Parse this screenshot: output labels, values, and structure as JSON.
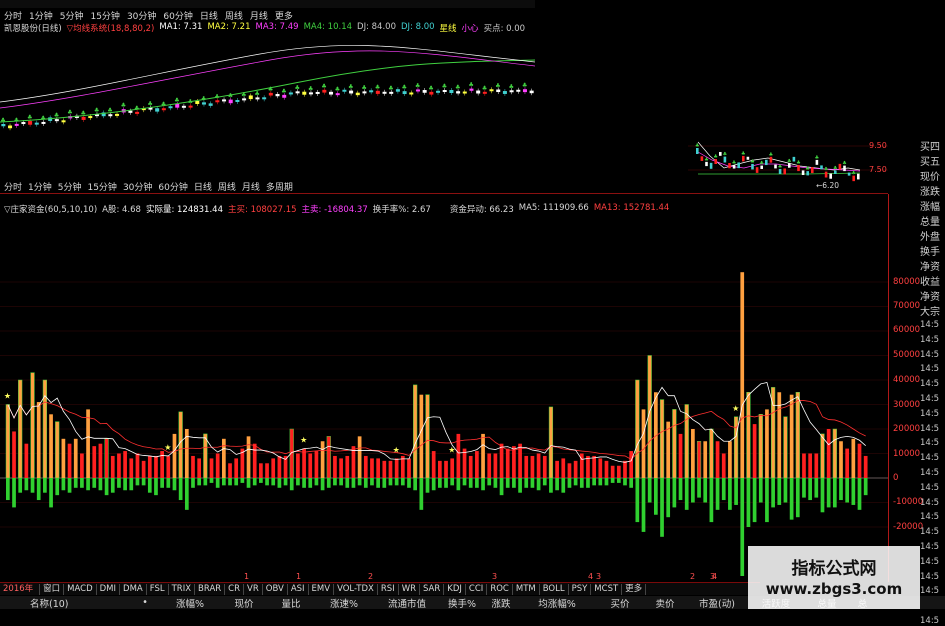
{
  "top_periods": [
    "分时",
    "1分钟",
    "5分钟",
    "15分钟",
    "30分钟",
    "60分钟",
    "日线",
    "周线",
    "月线",
    "更多"
  ],
  "main_legend": {
    "stock": "凯恩股份(日线)",
    "indicator": "▽均线系统(18,8,80,2)",
    "ma1": "MA1: 7.31",
    "ma2": "MA2: 7.21",
    "ma3": "MA3: 7.49",
    "ma4": "MA4: 10.14",
    "dj": "DJ: 84.00",
    "dj2": "DJ: 8.00",
    "xingdi": "星线",
    "xiaoxin": "小心",
    "maidian": "买点: 0.00"
  },
  "second_periods": [
    "分时",
    "1分钟",
    "5分钟",
    "15分钟",
    "30分钟",
    "60分钟",
    "日线",
    "周线",
    "月线",
    "多周期"
  ],
  "ind_legend": {
    "name": "▽庄家资金(60,5,10,10)",
    "a": "A股: 4.68",
    "sjl": "实际量: 124831.44",
    "zhuru": "主买: 108027.15",
    "zhumai": "主卖: -16804.37",
    "hsl": "换手率%: 2.67",
    "zjyd": "资金异动: 66.23",
    "ma5": "MA5: 111909.66",
    "ma13": "MA13: 152781.44"
  },
  "mini_chart": {
    "label_950": "9.50",
    "label_750": "7.50",
    "arrow_label": "←6.20"
  },
  "y_axis": [
    {
      "v": "80000",
      "y": 282
    },
    {
      "v": "70000",
      "y": 306
    },
    {
      "v": "60000",
      "y": 330
    },
    {
      "v": "50000",
      "y": 355
    },
    {
      "v": "40000",
      "y": 380
    },
    {
      "v": "30000",
      "y": 405
    },
    {
      "v": "20000",
      "y": 429
    },
    {
      "v": "10000",
      "y": 454
    },
    {
      "v": "0",
      "y": 478
    },
    {
      "v": "-10000",
      "y": 502
    },
    {
      "v": "-20000",
      "y": 527
    }
  ],
  "right_panel": [
    "买四",
    "买五",
    "现价",
    "涨跌",
    "涨幅",
    "总量",
    "外盘",
    "换手",
    "净资",
    "收益",
    "净资",
    "大宗"
  ],
  "right_times": [
    "14:5",
    "14:5",
    "14:5",
    "14:5",
    "14:5",
    "14:5",
    "14:5",
    "14:5",
    "14:5",
    "14:5",
    "14:5",
    "14:5",
    "14:5",
    "14:5",
    "14:5",
    "14:5",
    "14:5",
    "14:5",
    "14:5",
    "14:5",
    "14:5"
  ],
  "tabs": [
    "2016年",
    "窗口",
    "MACD",
    "DMI",
    "DMA",
    "FSL",
    "TRIX",
    "BRAR",
    "CR",
    "VR",
    "OBV",
    "ASI",
    "EMV",
    "VOL-TDX",
    "RSI",
    "WR",
    "SAR",
    "KDJ",
    "CCI",
    "ROC",
    "MTM",
    "BOLL",
    "PSY",
    "MCST",
    "更多"
  ],
  "header_cols": [
    "名称(10)",
    "•",
    "涨幅%",
    "现价",
    "量比",
    "涨速%",
    "流通市值",
    "换手%",
    "涨跌",
    "均涨幅%",
    "买价",
    "卖价",
    "市盈(动)",
    "活跃度",
    "总量",
    "总"
  ],
  "watermark": {
    "title": "指标公式网",
    "url": "www.zbgs3.com"
  },
  "markers": [
    "1",
    "1",
    "2",
    "3",
    "4",
    "3",
    "2",
    "3",
    "4"
  ],
  "chart_data": {
    "type": "bar",
    "series": [
      {
        "values": [
          30,
          19,
          40,
          14,
          43,
          31,
          40,
          26,
          23,
          16,
          14,
          16,
          10,
          28,
          13,
          14,
          16,
          9,
          10,
          11,
          8,
          10,
          7,
          9,
          9,
          11,
          9,
          18,
          27,
          20,
          9,
          8,
          18,
          8,
          10,
          16,
          6,
          8,
          12,
          17,
          14,
          6,
          6,
          8,
          9,
          9,
          20,
          10,
          12,
          10,
          11,
          15,
          17,
          9,
          8,
          9,
          13,
          17,
          9,
          8,
          8,
          7,
          7,
          8,
          9,
          8,
          38,
          34,
          34,
          11,
          7,
          7,
          8,
          18,
          12,
          9,
          11,
          18,
          10,
          10,
          14,
          12,
          13,
          14,
          9,
          9,
          10,
          9,
          29,
          7,
          8,
          6,
          7,
          10,
          9,
          9,
          8,
          7,
          5,
          5,
          7,
          11,
          40,
          28,
          50,
          35,
          32,
          23,
          28,
          18,
          30,
          20,
          15,
          15,
          20,
          15,
          10,
          15,
          25,
          84,
          35,
          22,
          26,
          28,
          37,
          35,
          25,
          34,
          35,
          10,
          10,
          10,
          18,
          20,
          20,
          15,
          12,
          16,
          14,
          9
        ]
      },
      {
        "values": [
          -9,
          -12,
          -6,
          -5,
          -6,
          -9,
          -6,
          -12,
          -7,
          -5,
          -6,
          -4,
          -4,
          -5,
          -4,
          -5,
          -7,
          -6,
          -4,
          -5,
          -5,
          -3,
          -3,
          -6,
          -7,
          -4,
          -4,
          -5,
          -9,
          -13,
          -4,
          -3,
          -3,
          -2,
          -4,
          -3,
          -3,
          -3,
          -2,
          -4,
          -3,
          -2,
          -3,
          -3,
          -4,
          -3,
          -5,
          -3,
          -4,
          -4,
          -3,
          -5,
          -4,
          -3,
          -3,
          -4,
          -4,
          -3,
          -4,
          -3,
          -4,
          -4,
          -3,
          -3,
          -3,
          -4,
          -5,
          -13,
          -6,
          -5,
          -4,
          -4,
          -3,
          -5,
          -3,
          -4,
          -4,
          -5,
          -3,
          -4,
          -7,
          -4,
          -4,
          -6,
          -4,
          -4,
          -5,
          -3,
          -6,
          -5,
          -6,
          -4,
          -3,
          -4,
          -4,
          -3,
          -3,
          -3,
          -2,
          -2,
          -3,
          -4,
          -18,
          -22,
          -10,
          -15,
          -24,
          -16,
          -12,
          -9,
          -13,
          -10,
          -8,
          -10,
          -18,
          -13,
          -9,
          -13,
          -11,
          -45,
          -20,
          -18,
          -10,
          -18,
          -12,
          -11,
          -10,
          -17,
          -16,
          -8,
          -9,
          -8,
          -14,
          -12,
          -12,
          -9,
          -10,
          -11,
          -13,
          -7
        ]
      }
    ],
    "ylim": [
      -45000,
      95000
    ],
    "yticks": [
      80000,
      70000,
      60000,
      50000,
      40000,
      30000,
      20000,
      10000,
      0,
      -10000,
      -20000
    ]
  },
  "colors": {
    "up": "#ff2020",
    "up_bar_orange": "#ffa040",
    "down": "#22dd22",
    "grid": "#b01818",
    "text": "#c8c8c8",
    "ma_white": "#ffffff",
    "ma_magenta": "#ff40ff",
    "ma_green": "#40d040"
  }
}
